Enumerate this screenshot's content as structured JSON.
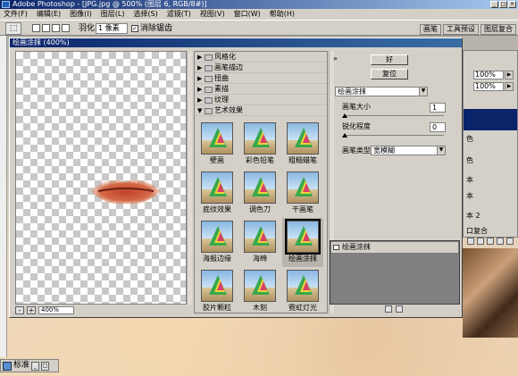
{
  "app": {
    "title": "Adobe Photoshop - [JPG.jpg @ 500% (图层 6, RGB/8#)]",
    "window_controls": [
      "_",
      "□",
      "×"
    ]
  },
  "menubar": [
    "文件(F)",
    "编辑(E)",
    "图像(I)",
    "图层(L)",
    "选择(S)",
    "滤镜(T)",
    "视图(V)",
    "窗口(W)",
    "帮助(H)"
  ],
  "options": {
    "feather_label": "羽化:",
    "feather_value": "1 像素",
    "antialias_label": "消除锯齿",
    "antialias_checked": "✓"
  },
  "palette_tabs": [
    "画笔",
    "工具预设",
    "图层复合"
  ],
  "right_panel": {
    "pct1": "100%",
    "pct2": "100%",
    "row_labels": [
      "色",
      "色",
      "本",
      "本",
      "本 2",
      "口复合"
    ]
  },
  "dialog": {
    "title": "绘画涂抹 (400%)",
    "zoom": "400%",
    "zoom_minus": "-",
    "zoom_plus": "+",
    "collapse": "»",
    "ok": "好",
    "reset": "复位",
    "categories": [
      {
        "label": "风格化",
        "expanded": false
      },
      {
        "label": "画笔描边",
        "expanded": false
      },
      {
        "label": "扭曲",
        "expanded": false
      },
      {
        "label": "素描",
        "expanded": false
      },
      {
        "label": "纹理",
        "expanded": false
      },
      {
        "label": "艺术效果",
        "expanded": true
      }
    ],
    "filters": [
      "壁画",
      "彩色铅笔",
      "粗糙蜡笔",
      "底纹效果",
      "调色刀",
      "干画笔",
      "海报边缘",
      "海绵",
      "绘画涂抹",
      "胶片颗粒",
      "木刻",
      "霓虹灯光"
    ],
    "selected_filter": "绘画涂抹",
    "filter_select": "绘画涂抹",
    "params": {
      "brush_size_label": "画笔大小",
      "brush_size": "1",
      "sharpness_label": "锐化程度",
      "sharpness": "0",
      "brush_type_label": "画笔类型:",
      "brush_type": "宽模糊"
    },
    "layer_item": "绘画涂抹"
  },
  "statusbar": {
    "label": "标准"
  }
}
